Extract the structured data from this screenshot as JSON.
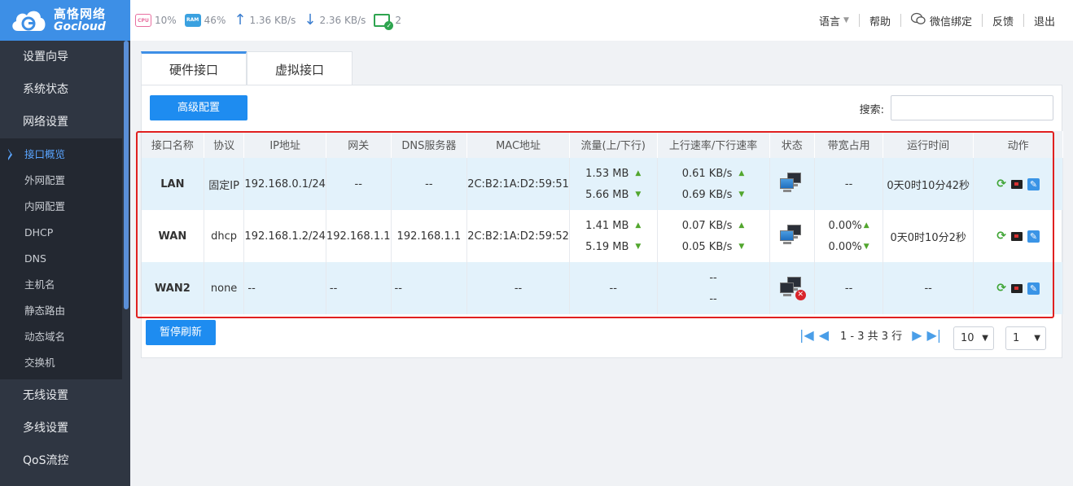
{
  "brand": {
    "name_cn": "高恪网络",
    "name_en": "Gocloud"
  },
  "stats": {
    "cpu_chip": "CPU",
    "cpu": "10%",
    "ram_chip": "RAM",
    "ram": "46%",
    "upload": "1.36 KB/s",
    "download": "2.36 KB/s",
    "devices": "2"
  },
  "topnav": {
    "language": "语言",
    "help": "帮助",
    "wechat": "微信绑定",
    "feedback": "反馈",
    "logout": "退出"
  },
  "sidebar": {
    "top": [
      "设置向导",
      "系统状态",
      "网络设置"
    ],
    "sub": [
      "接口概览",
      "外网配置",
      "内网配置",
      "DHCP",
      "DNS",
      "主机名",
      "静态路由",
      "动态域名",
      "交换机"
    ],
    "bottom": [
      "无线设置",
      "多线设置",
      "QoS流控"
    ]
  },
  "tabs": [
    "硬件接口",
    "虚拟接口"
  ],
  "toolbar": {
    "advanced": "高级配置",
    "search_label": "搜索:",
    "search_value": "",
    "pause": "暂停刷新"
  },
  "table": {
    "headers": [
      "接口名称",
      "协议",
      "IP地址",
      "网关",
      "DNS服务器",
      "MAC地址",
      "流量(上/下行)",
      "上行速率/下行速率",
      "状态",
      "带宽占用",
      "运行时间",
      "动作"
    ],
    "rows": [
      {
        "name": "LAN",
        "proto": "固定IP",
        "ip": "192.168.0.1/24",
        "gw": "--",
        "dns": "--",
        "mac": "2C:B2:1A:D2:59:51",
        "traffic_up": "1.53 MB",
        "traffic_down": "5.66 MB",
        "rate_up": "0.61 KB/s",
        "rate_down": "0.69 KB/s",
        "status": "online",
        "bw": "--",
        "bw2": "",
        "uptime": "0天0时10分42秒"
      },
      {
        "name": "WAN",
        "proto": "dhcp",
        "ip": "192.168.1.2/24",
        "gw": "192.168.1.1",
        "dns": "192.168.1.1",
        "mac": "2C:B2:1A:D2:59:52",
        "traffic_up": "1.41 MB",
        "traffic_down": "5.19 MB",
        "rate_up": "0.07 KB/s",
        "rate_down": "0.05 KB/s",
        "status": "online",
        "bw": "0.00%",
        "bw2": "0.00%",
        "uptime": "0天0时10分2秒"
      },
      {
        "name": "WAN2",
        "proto": "none",
        "ip": "--",
        "gw": "--",
        "dns": "--",
        "mac": "--",
        "traffic": "--",
        "rate_up": "--",
        "rate_down": "--",
        "status": "offline",
        "bw": "--",
        "uptime": "--"
      }
    ]
  },
  "pager": {
    "info": "1 - 3 共 3 行",
    "page_size": "10",
    "page": "1"
  }
}
